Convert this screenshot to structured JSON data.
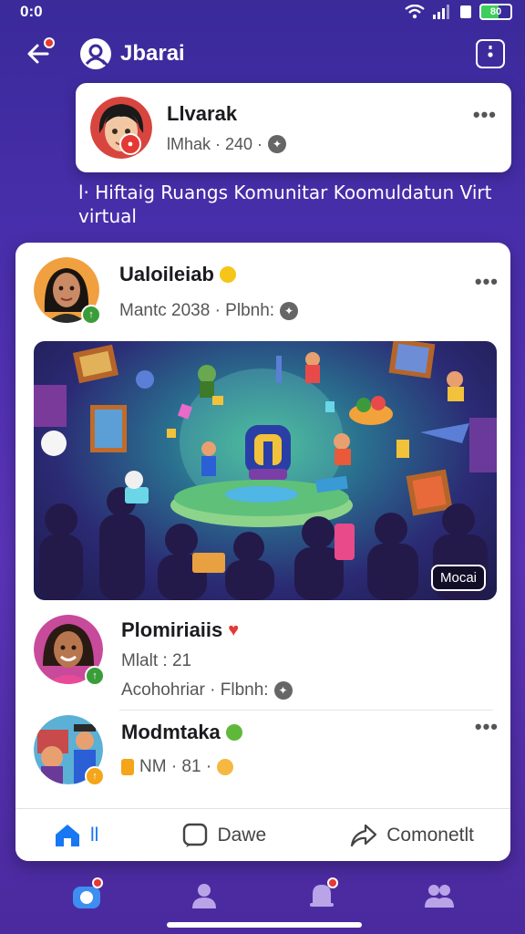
{
  "status_bar": {
    "time": "0:0",
    "battery": "80"
  },
  "app_bar": {
    "title": "Jbarai"
  },
  "profile_card": {
    "name": "Llvarak",
    "meta": "lMhak · 240 ·"
  },
  "caption": "l· Hiftaig Ruangs Komunitar Koomuldatun Virt virtual",
  "post": {
    "author": "Ualoileiab",
    "meta": "Mantc 2038 · Plbnh:",
    "media_tag": "Mocai"
  },
  "comments": [
    {
      "name": "Plomiriaiis",
      "line1": "Mlalt : 21",
      "line2": "Acohohriar · Flbnh:"
    },
    {
      "name": "Modmtaka",
      "line1": "NM · 81 ·"
    }
  ],
  "actions": {
    "like": "ll",
    "share": "Dawe",
    "comment": "Comonetlt"
  },
  "colors": {
    "accent": "#1877f2",
    "background": "#4b2fae",
    "badge": "#e53935",
    "verified": "#f5c518"
  },
  "icons": [
    "back-arrow-icon",
    "app-logo-icon",
    "share-box-icon",
    "more-icon",
    "globe-icon",
    "home-icon",
    "comment-icon",
    "share-arrow-icon",
    "camera-icon",
    "profile-icon",
    "bell-icon",
    "friends-icon"
  ]
}
